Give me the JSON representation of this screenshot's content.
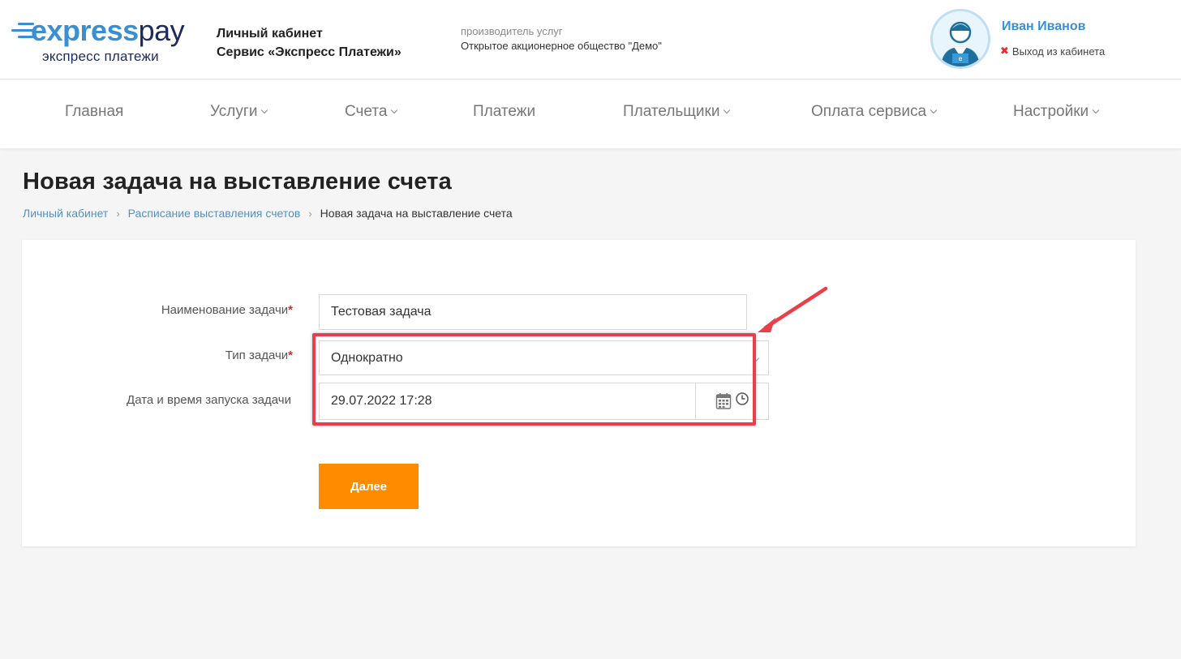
{
  "header": {
    "logo": {
      "word_a": "express",
      "word_b": "pay",
      "subtitle": "экспресс платежи"
    },
    "cabinet_line1": "Личный кабинет",
    "cabinet_line2": "Сервис «Экспресс Платежи»",
    "provider_label": "производитель услуг",
    "provider_name": "Открытое акционерное общество \"Демо\"",
    "user_name": "Иван Иванов",
    "logout_label": "Выход из кабинета"
  },
  "nav": {
    "items": [
      {
        "label": "Главная",
        "dropdown": false
      },
      {
        "label": "Услуги",
        "dropdown": true
      },
      {
        "label": "Счета",
        "dropdown": true
      },
      {
        "label": "Платежи",
        "dropdown": false
      },
      {
        "label": "Плательщики",
        "dropdown": true
      },
      {
        "label": "Оплата сервиса",
        "dropdown": true
      },
      {
        "label": "Настройки",
        "dropdown": true
      }
    ]
  },
  "page": {
    "title": "Новая задача на выставление счета",
    "breadcrumb": [
      "Личный кабинет",
      "Расписание выставления счетов",
      "Новая задача на выставление счета"
    ]
  },
  "form": {
    "task_name_label": "Наименование задачи",
    "task_name_value": "Тестовая задача",
    "task_type_label": "Тип задачи",
    "task_type_value": "Однократно",
    "datetime_label": "Дата и время запуска задачи",
    "datetime_value": "29.07.2022 17:28",
    "required_mark": "*",
    "next_button": "Далее"
  },
  "colors": {
    "brand_blue": "#3a8fd3",
    "brand_navy": "#1d2a5c",
    "accent_orange": "#ff8c00",
    "required_red": "#e02424",
    "annotation_red": "#e8404a"
  }
}
